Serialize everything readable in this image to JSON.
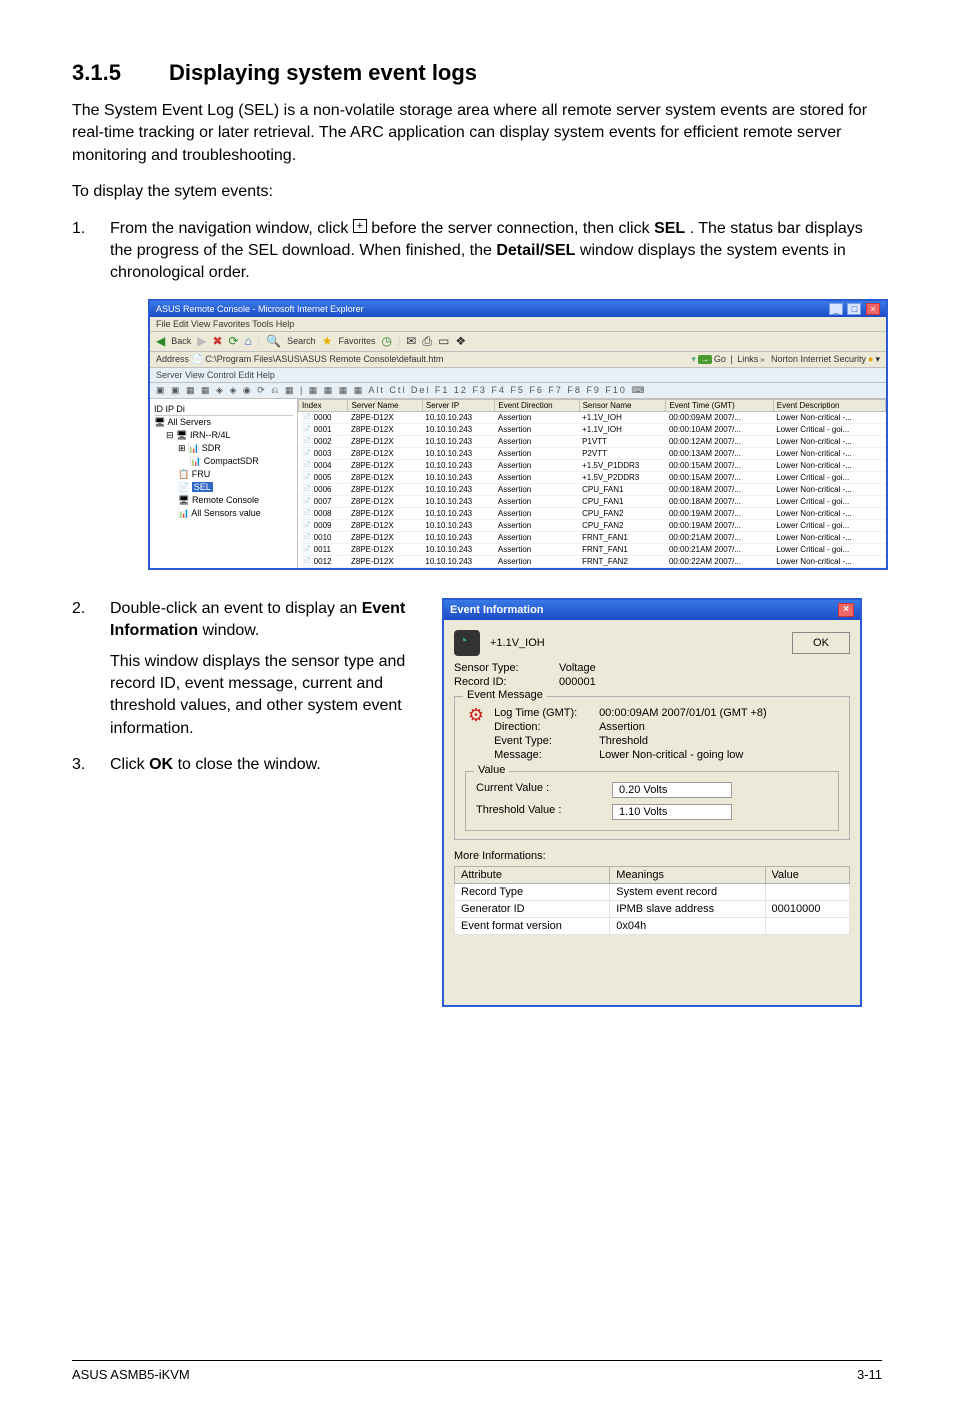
{
  "section": {
    "number": "3.1.5",
    "title": "Displaying system event logs"
  },
  "para1": "The System Event Log (SEL) is a non-volatile storage area where all remote server system events are stored for real-time tracking or later retrieval. The ARC application can display system events for efficient remote server monitoring and troubleshooting.",
  "para2": "To display the sytem events:",
  "step1": {
    "num": "1.",
    "text_a": "From the navigation window, click ",
    "text_b": " before the server connection, then click ",
    "bold_b": "SEL",
    "text_c": ". The status bar displays the progress of the SEL download. When finished, the ",
    "bold_c": "Detail/SEL",
    "text_d": " window displays the system events in chronological order."
  },
  "ie": {
    "title": "ASUS Remote Console - Microsoft Internet Explorer",
    "menu": "File   Edit   View   Favorites   Tools   Help",
    "toolbarA": {
      "back": "Back",
      "search": "Search",
      "fav": "Favorites"
    },
    "address_label": "Address",
    "address": "C:\\Program Files\\ASUS\\ASUS Remote Console\\default.htm",
    "go": "Go",
    "links": "Links",
    "norton": "Norton Internet Security",
    "innermenu": "Server   View   Control   Edit   Help",
    "toolicons": "▣ ▣ ▦ ▦ ◈ ◈ ◉ ⟳ ⎌ ▦ | ▦ ▦ ▦ ▦ Alt Ctl Del F1 12 F3 F4 F5 F6 F7 F8 F9 F10 ⌨",
    "tree": {
      "cols": "ID   IP   Di",
      "root": "All Servers",
      "server": "IRN--R/4L",
      "n1": "SDR",
      "n2": "CompactSDR",
      "n3": "FRU",
      "sel": "SEL",
      "n4": "Remote Console",
      "n5": "All Sensors value"
    },
    "grid": {
      "headers": [
        "Index",
        "Server Name",
        "Server IP",
        "Event Direction",
        "Sensor Name",
        "Event Time (GMT)",
        "Event Description"
      ],
      "rows": [
        [
          "0000",
          "Z8PE-D12X",
          "10.10.10.243",
          "Assertion",
          "+1.1V_IOH",
          "00:00:09AM 2007/...",
          "Lower Non-critical -..."
        ],
        [
          "0001",
          "Z8PE-D12X",
          "10.10.10.243",
          "Assertion",
          "+1.1V_IOH",
          "00:00:10AM 2007/...",
          "Lower Critical - goi..."
        ],
        [
          "0002",
          "Z8PE-D12X",
          "10.10.10.243",
          "Assertion",
          "P1VTT",
          "00:00:12AM 2007/...",
          "Lower Non-critical -..."
        ],
        [
          "0003",
          "Z8PE-D12X",
          "10.10.10.243",
          "Assertion",
          "P2VTT",
          "00:00:13AM 2007/...",
          "Lower Non-critical -..."
        ],
        [
          "0004",
          "Z8PE-D12X",
          "10.10.10.243",
          "Assertion",
          "+1.5V_P1DDR3",
          "00:00:15AM 2007/...",
          "Lower Non-critical -..."
        ],
        [
          "0005",
          "Z8PE-D12X",
          "10.10.10.243",
          "Assertion",
          "+1.5V_P2DDR3",
          "00:00:15AM 2007/...",
          "Lower Critical - goi..."
        ],
        [
          "0006",
          "Z8PE-D12X",
          "10.10.10.243",
          "Assertion",
          "CPU_FAN1",
          "00:00:18AM 2007/...",
          "Lower Non-critical -..."
        ],
        [
          "0007",
          "Z8PE-D12X",
          "10.10.10.243",
          "Assertion",
          "CPU_FAN1",
          "00:00:18AM 2007/...",
          "Lower Critical - goi..."
        ],
        [
          "0008",
          "Z8PE-D12X",
          "10.10.10.243",
          "Assertion",
          "CPU_FAN2",
          "00:00:19AM 2007/...",
          "Lower Non-critical -..."
        ],
        [
          "0009",
          "Z8PE-D12X",
          "10.10.10.243",
          "Assertion",
          "CPU_FAN2",
          "00:00:19AM 2007/...",
          "Lower Critical - goi..."
        ],
        [
          "0010",
          "Z8PE-D12X",
          "10.10.10.243",
          "Assertion",
          "FRNT_FAN1",
          "00:00:21AM 2007/...",
          "Lower Non-critical -..."
        ],
        [
          "0011",
          "Z8PE-D12X",
          "10.10.10.243",
          "Assertion",
          "FRNT_FAN1",
          "00:00:21AM 2007/...",
          "Lower Critical - goi..."
        ],
        [
          "0012",
          "Z8PE-D12X",
          "10.10.10.243",
          "Assertion",
          "FRNT_FAN2",
          "00:00:22AM 2007/...",
          "Lower Non-critical -..."
        ]
      ]
    }
  },
  "step2": {
    "num": "2.",
    "text_a": "Double-click an event to display an ",
    "bold_a": "Event Information",
    "text_b": " window.",
    "para2": "This window displays the sensor type and record ID, event message, current and threshold values, and other system event information."
  },
  "step3": {
    "num": "3.",
    "text_a": "Click ",
    "bold_a": "OK",
    "text_b": " to close the window."
  },
  "dlg": {
    "title": "Event Information",
    "head_value": "+1.1V_IOH",
    "ok": "OK",
    "sensor_type_lab": "Sensor Type:",
    "sensor_type_val": "Voltage",
    "record_id_lab": "Record ID:",
    "record_id_val": "000001",
    "fs1_legend": "Event Message",
    "msg": {
      "logtime_lab": "Log Time (GMT):",
      "logtime_val": "00:00:09AM 2007/01/01 (GMT +8)",
      "dir_lab": "Direction:",
      "dir_val": "Assertion",
      "etype_lab": "Event Type:",
      "etype_val": "Threshold",
      "message_lab": "Message:",
      "message_val": "Lower Non-critical - going low"
    },
    "fs2_legend": "Value",
    "cur_lab": "Current Value :",
    "cur_val": "0.20 Volts",
    "thr_lab": "Threshold Value :",
    "thr_val": "1.10 Volts",
    "more_label": "More Informations:",
    "table": {
      "headers": [
        "Attribute",
        "Meanings",
        "Value"
      ],
      "rows": [
        [
          "Record Type",
          "System event record",
          ""
        ],
        [
          "Generator ID",
          "IPMB slave address",
          "00010000"
        ],
        [
          "Event format version",
          "0x04h",
          ""
        ]
      ]
    }
  },
  "footer": {
    "left": "ASUS ASMB5-iKVM",
    "right": "3-11"
  }
}
